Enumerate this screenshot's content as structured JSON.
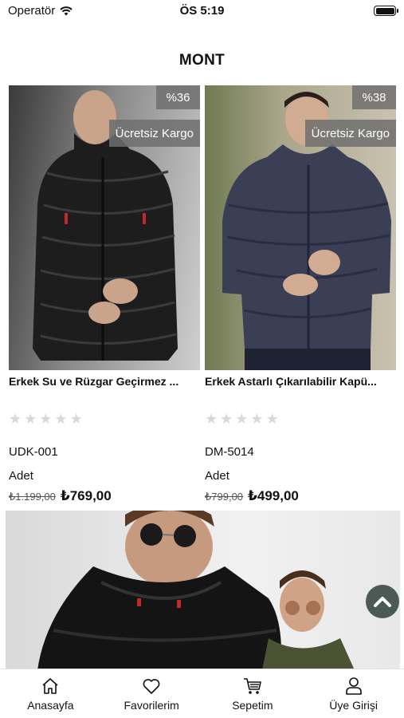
{
  "status_bar": {
    "carrier": "Operatör",
    "time": "ÖS 5:19"
  },
  "page_title": "MONT",
  "products": [
    {
      "discount": "%36",
      "shipping": "Ücretsiz Kargo",
      "name": "Erkek Su ve Rüzgar Geçirmez ...",
      "rating": 0,
      "code": "UDK-001",
      "unit": "Adet",
      "old_price": "₺1.199,00",
      "price": "₺769,00"
    },
    {
      "discount": "%38",
      "shipping": "Ücretsiz Kargo",
      "name": "Erkek Astarlı Çıkarılabilir Kapü...",
      "rating": 0,
      "code": "DM-5014",
      "unit": "Adet",
      "old_price": "₺799,00",
      "price": "₺499,00"
    }
  ],
  "tab_bar": [
    {
      "label": "Anasayfa",
      "icon": "home-icon"
    },
    {
      "label": "Favorilerim",
      "icon": "heart-icon"
    },
    {
      "label": "Sepetim",
      "icon": "cart-icon"
    },
    {
      "label": "Üye Girişi",
      "icon": "user-icon"
    }
  ],
  "colors": {
    "badge": "#6e6e6e",
    "scroll_top": "#4b5a55",
    "star": "#d8d8d8"
  }
}
